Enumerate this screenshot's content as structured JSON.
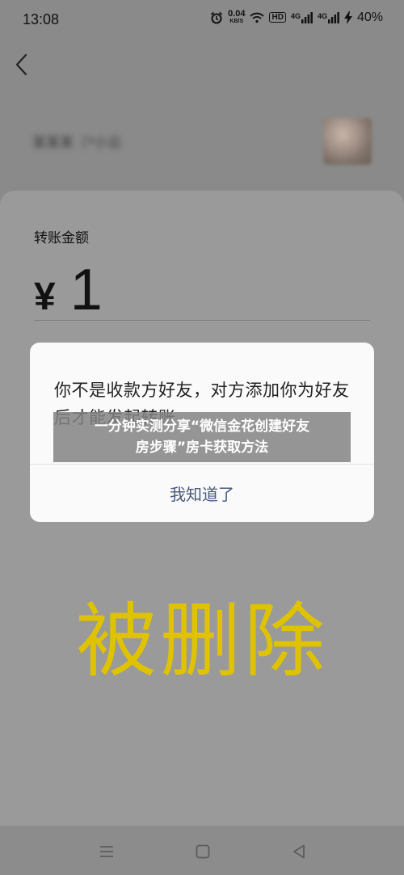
{
  "status_bar": {
    "time": "13:08",
    "net_speed_value": "0.04",
    "net_speed_unit": "KB/S",
    "hd_label": "HD",
    "signal_label_1": "4G",
    "signal_label_2": "4G",
    "battery": "40%"
  },
  "recipient": {
    "name": "某某某（*小云"
  },
  "transfer": {
    "amount_label": "转账金额",
    "currency_symbol": "¥",
    "amount": "1"
  },
  "dialog": {
    "message": "你不是收款方好友，对方添加你为好友后才能发起转账",
    "ok_label": "我知道了"
  },
  "banner": {
    "line1": "一分钟实测分享“微信金花创建好友",
    "line2": "房步骤”房卡获取方法"
  },
  "caption": "被删除",
  "colors": {
    "caption": "#e0c300",
    "dialog_button": "#4a5a7e"
  }
}
